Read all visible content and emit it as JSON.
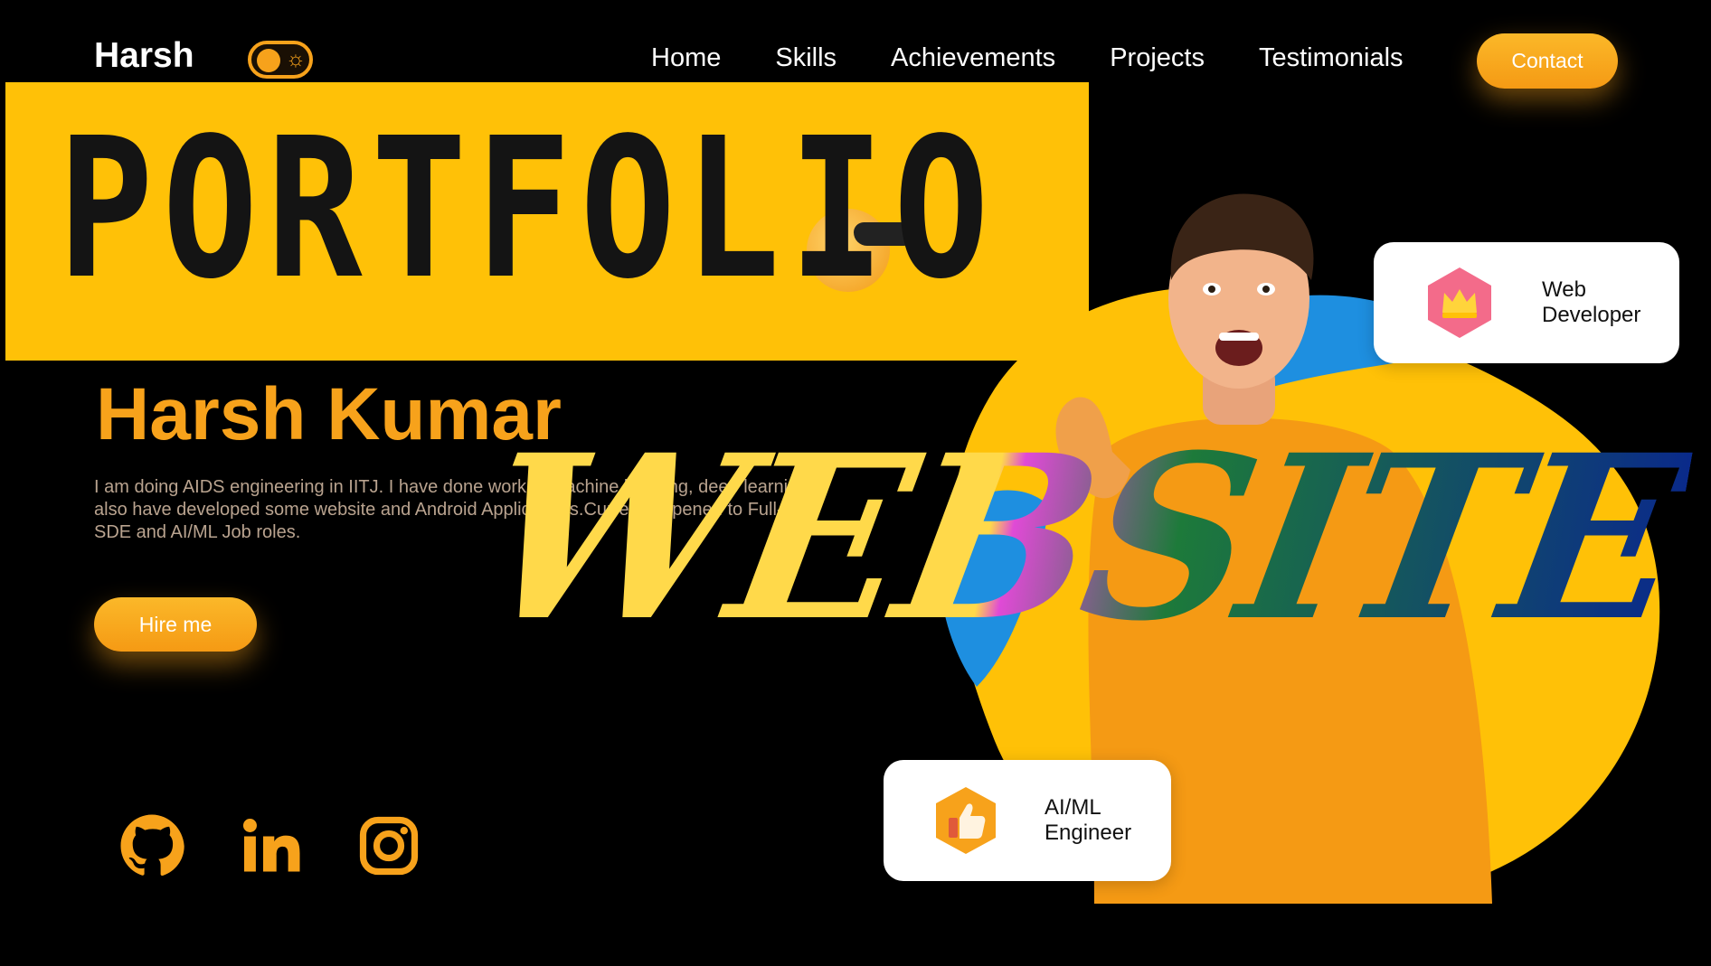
{
  "nav": {
    "brand": "Harsh",
    "links": [
      "Home",
      "Skills",
      "Achievements",
      "Projects",
      "Testimonials"
    ],
    "contact_label": "Contact",
    "theme_toggle_icon": "sun-icon"
  },
  "banner": {
    "text": "PORTFOLIO"
  },
  "hero": {
    "name": "Harsh Kumar",
    "description": "I am doing AIDS engineering in IITJ. I have done work in machine learning, deep learning also have developed some website and Android Applications.Currently opened to Full-time SDE and AI/ML Job roles.",
    "hire_label": "Hire me"
  },
  "overlay_text": "WEBSITE",
  "cards": [
    {
      "line1": "Web",
      "line2": "Developer",
      "icon": "crown-icon"
    },
    {
      "line1": "AI/ML",
      "line2": "Engineer",
      "icon": "thumbs-up-icon"
    }
  ],
  "social": [
    "github-icon",
    "linkedin-icon",
    "instagram-icon"
  ],
  "colors": {
    "accent": "#f7a21b",
    "banner": "#ffc107",
    "blob_yellow": "#ffc107",
    "blob_blue": "#1e8fe0",
    "background": "#000000"
  }
}
